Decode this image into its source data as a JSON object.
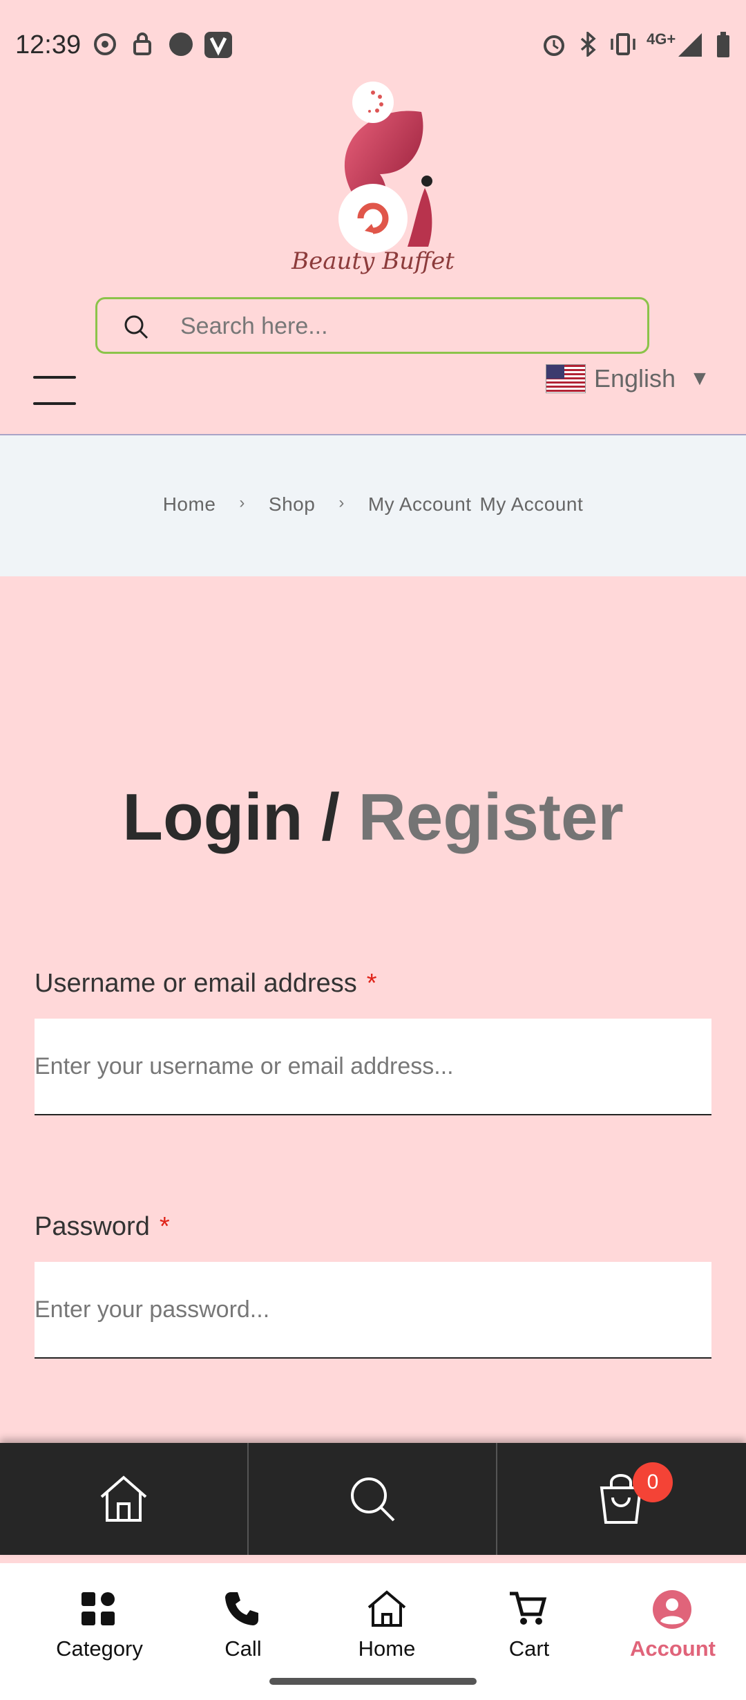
{
  "status_bar": {
    "time": "12:39",
    "network": "4G+"
  },
  "header": {
    "logo_text": "Beauty Buffet",
    "search": {
      "placeholder": "Search here..."
    },
    "language": {
      "label": "English",
      "arrow": "▼"
    }
  },
  "breadcrumb": {
    "items": [
      "Home",
      "Shop",
      "My Account",
      "My Account"
    ],
    "separator": "›"
  },
  "page": {
    "title_login": "Login",
    "title_slash": " / ",
    "title_register": "Register",
    "username": {
      "label": "Username or email address",
      "required": "*",
      "placeholder": "Enter your username or email address..."
    },
    "password": {
      "label": "Password",
      "required": "*",
      "placeholder": "Enter your password..."
    }
  },
  "dark_nav": {
    "cart_count": "0"
  },
  "bottom_tabs": [
    {
      "label": "Category",
      "icon": "grid-icon"
    },
    {
      "label": "Call",
      "icon": "phone-icon"
    },
    {
      "label": "Home",
      "icon": "home-icon"
    },
    {
      "label": "Cart",
      "icon": "cart-icon"
    },
    {
      "label": "Account",
      "icon": "account-icon",
      "active": true
    }
  ],
  "colors": {
    "background": "#ffd8d9",
    "search_border": "#8bc34a",
    "accent": "#e0647a",
    "badge": "#f44336",
    "dark_nav": "#262626"
  }
}
